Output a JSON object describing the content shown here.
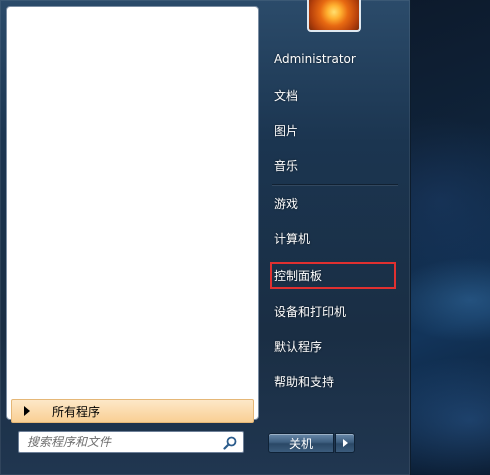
{
  "user": {
    "name": "Administrator"
  },
  "left_panel": {
    "all_programs": "所有程序",
    "search_placeholder": "搜索程序和文件"
  },
  "right_panel": {
    "items": [
      "文档",
      "图片",
      "音乐",
      "游戏",
      "计算机",
      "控制面板",
      "设备和打印机",
      "默认程序",
      "帮助和支持"
    ],
    "highlighted_item": "控制面板"
  },
  "shutdown": {
    "label": "关机"
  },
  "colors": {
    "highlight_border": "#e03030",
    "all_programs_bg": "#f9cf94"
  },
  "icons": {
    "search": "search-icon",
    "user_picture": "flower-avatar-icon",
    "expand": "triangle-right-icon"
  }
}
